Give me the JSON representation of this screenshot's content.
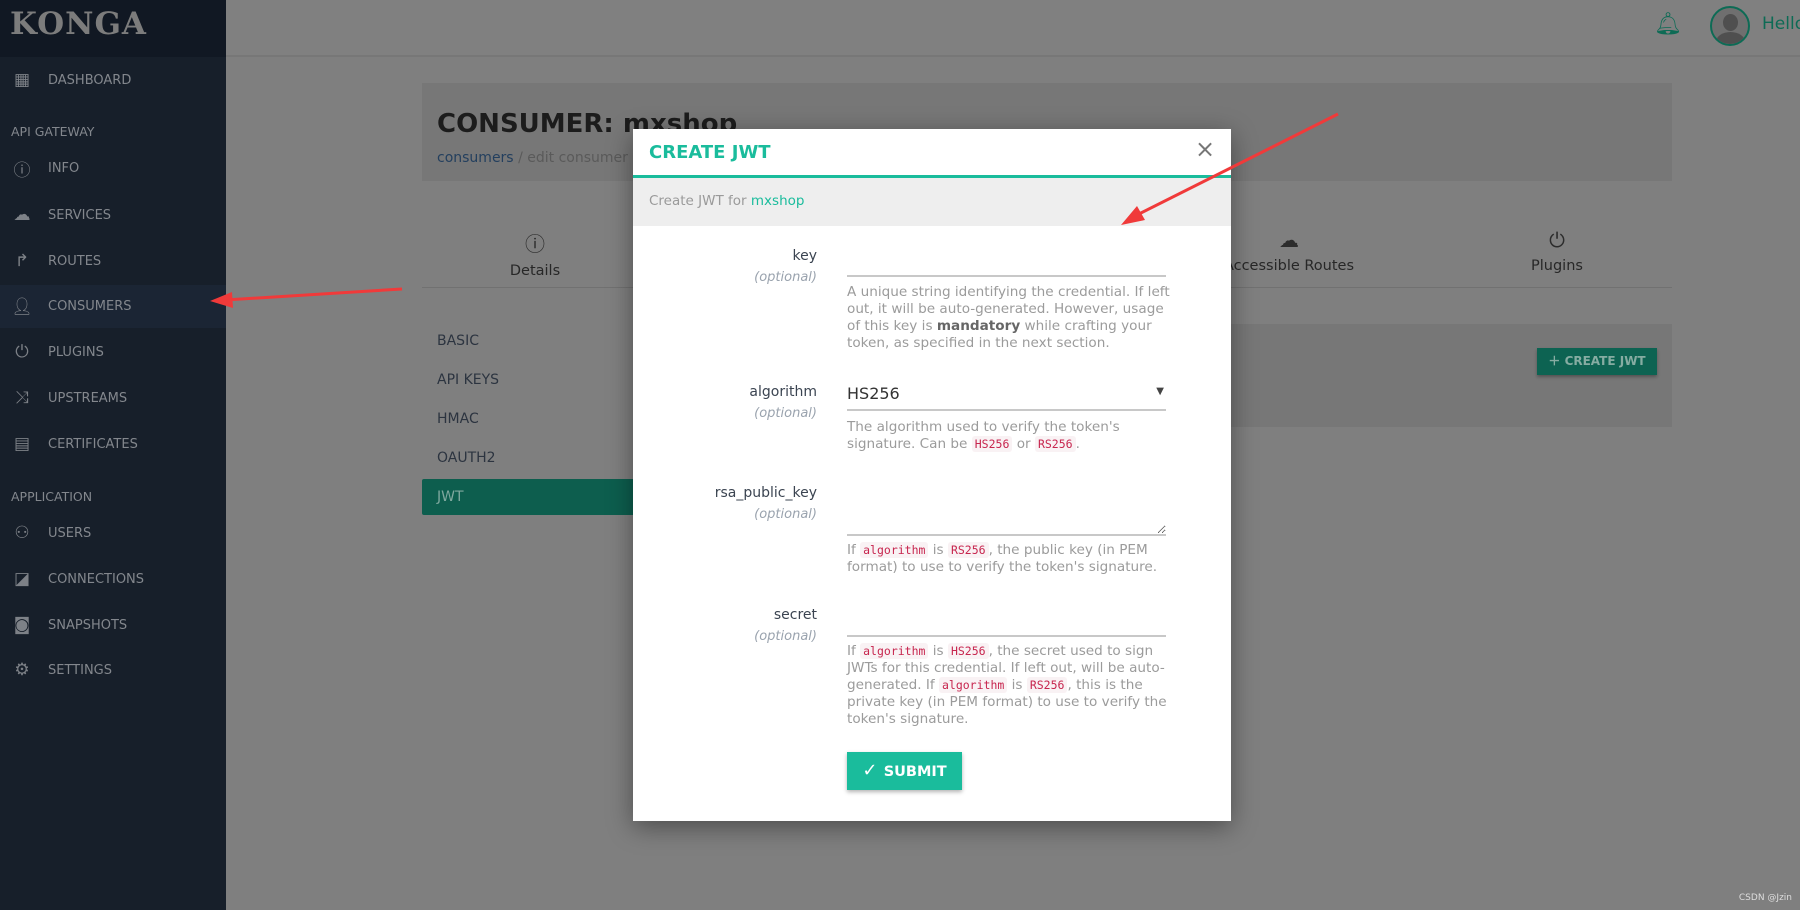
{
  "app": {
    "logo": "KONGA",
    "watermark": "CSDN @Jzin"
  },
  "sidebar": {
    "dashboard": "DASHBOARD",
    "sections": [
      "API GATEWAY",
      "APPLICATION"
    ],
    "gateway_items": [
      {
        "label": "INFO",
        "icon": "info-icon"
      },
      {
        "label": "SERVICES",
        "icon": "cloud-icon"
      },
      {
        "label": "ROUTES",
        "icon": "routes-icon"
      },
      {
        "label": "CONSUMERS",
        "icon": "user-icon"
      },
      {
        "label": "PLUGINS",
        "icon": "plug-icon"
      },
      {
        "label": "UPSTREAMS",
        "icon": "shuffle-icon"
      },
      {
        "label": "CERTIFICATES",
        "icon": "certificate-icon"
      }
    ],
    "app_items": [
      {
        "label": "USERS",
        "icon": "users-icon"
      },
      {
        "label": "CONNECTIONS",
        "icon": "cast-icon"
      },
      {
        "label": "SNAPSHOTS",
        "icon": "camera-icon"
      },
      {
        "label": "SETTINGS",
        "icon": "gear-icon"
      }
    ],
    "active": "CONSUMERS"
  },
  "topbar": {
    "greeting": "Hello,"
  },
  "page": {
    "title": "CONSUMER: mxshop",
    "breadcrumb": [
      "consumers",
      "edit consumer"
    ],
    "tabs": [
      {
        "label": "Details",
        "icon": "info-icon"
      },
      {
        "label": "Accessible Routes",
        "icon": "cloud-icon"
      },
      {
        "label": "Plugins",
        "icon": "plug-icon"
      }
    ],
    "credential_menu": [
      "BASIC",
      "API KEYS",
      "HMAC",
      "OAUTH2",
      "JWT"
    ],
    "active_credential": "JWT",
    "create_button": "CREATE JWT"
  },
  "modal": {
    "title": "CREATE JWT",
    "subtitle_prefix": "Create JWT for",
    "consumer": "mxshop",
    "optional": "(optional)",
    "fields": {
      "key": {
        "label": "key",
        "value": "",
        "help_1": "A unique string identifying the credential. If left out, it will be auto-generated. However, usage of this key is ",
        "help_bold": "mandatory",
        "help_2": " while crafting your token, as specified in the next section."
      },
      "algorithm": {
        "label": "algorithm",
        "value": "HS256",
        "help_1": "The algorithm used to verify the token's signature. Can be ",
        "code_1": "HS256",
        "help_2": " or ",
        "code_2": "RS256",
        "help_3": "."
      },
      "rsa_public_key": {
        "label": "rsa_public_key",
        "value": "",
        "help_1": "If ",
        "code_1": "algorithm",
        "help_2": " is ",
        "code_2": "RS256",
        "help_3": ", the public key (in PEM format) to use to verify the token's signature."
      },
      "secret": {
        "label": "secret",
        "value": "",
        "help_1": "If ",
        "code_1": "algorithm",
        "help_2": " is ",
        "code_2": "HS256",
        "help_3": ", the secret used to sign JWTs for this credential. If left out, will be auto-generated. If ",
        "code_3": "algorithm",
        "help_4": " is ",
        "code_4": "RS256",
        "help_5": ", this is the private key (in PEM format) to use to verify the token's signature."
      }
    },
    "submit": "SUBMIT"
  },
  "colors": {
    "accent": "#1abc9c",
    "annotation_arrow": "#f03a3a"
  }
}
